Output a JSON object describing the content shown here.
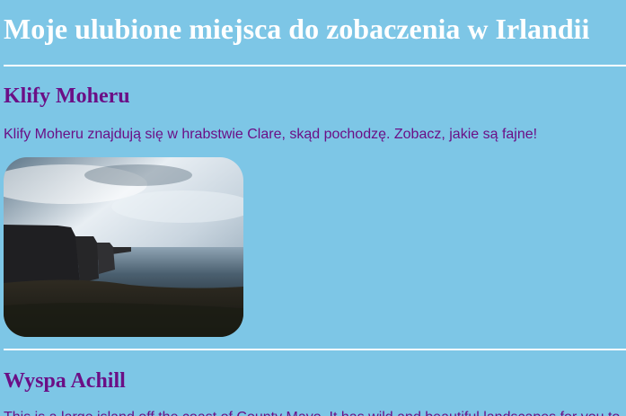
{
  "page": {
    "title": "Moje ulubione miejsca do zobaczenia w Irlandii"
  },
  "sections": [
    {
      "heading": "Klify Moheru",
      "text": "Klify Moheru znajdują się w hrabstwie Clare, skąd pochodzę. Zobacz, jakie są fajne!",
      "image": "cliffs-of-moher-photo"
    },
    {
      "heading": "Wyspa Achill",
      "text": "This is a large island off the coast of County Mayo. It has wild and beautiful landscapes for you to"
    }
  ],
  "colors": {
    "background": "#7dc6e6",
    "title": "#ffffff",
    "text": "#6b0f86",
    "rule": "#ffffff"
  }
}
